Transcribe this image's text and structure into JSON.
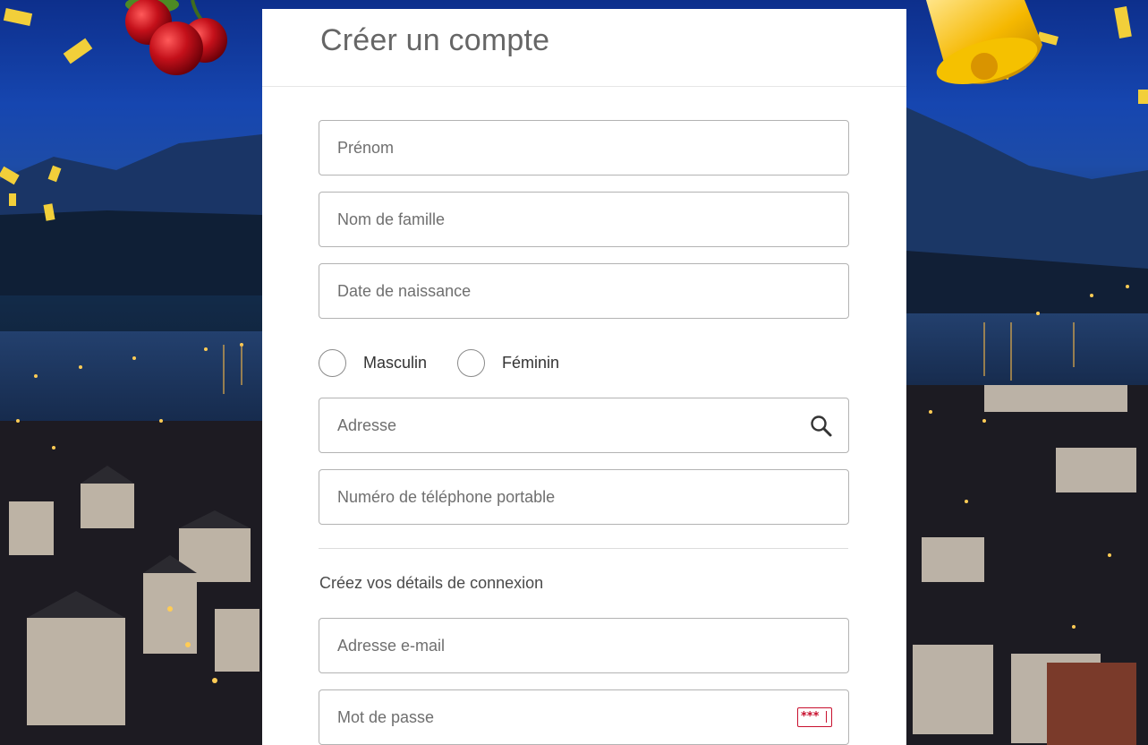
{
  "form": {
    "title": "Créer un compte",
    "fields": {
      "first_name": {
        "placeholder": "Prénom",
        "value": ""
      },
      "last_name": {
        "placeholder": "Nom de famille",
        "value": ""
      },
      "birth_date": {
        "placeholder": "Date de naissance",
        "value": ""
      },
      "address": {
        "placeholder": "Adresse",
        "value": ""
      },
      "mobile_phone": {
        "placeholder": "Numéro de téléphone portable",
        "value": ""
      },
      "email": {
        "placeholder": "Adresse e-mail",
        "value": ""
      },
      "password": {
        "placeholder": "Mot de passe",
        "value": ""
      }
    },
    "gender": {
      "options": [
        "Masculin",
        "Féminin"
      ]
    },
    "login_section_label": "Créez vos détails de connexion",
    "password_icon_text": "***"
  },
  "icons": {
    "address_icon": "search-icon",
    "password_icon": "password-mask-icon"
  },
  "colors": {
    "accent": "#c8102e",
    "card_background": "#ffffff",
    "field_border": "#b3b3b3",
    "title_text": "#666666"
  }
}
